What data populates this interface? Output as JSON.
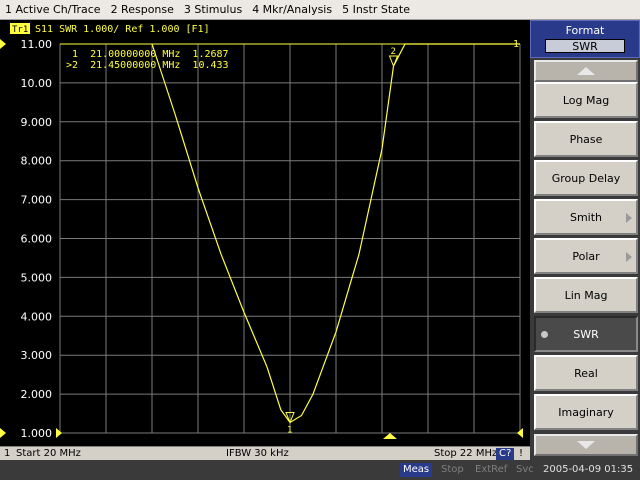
{
  "menu": [
    "1 Active Ch/Trace",
    "2 Response",
    "3 Stimulus",
    "4 Mkr/Analysis",
    "5 Instr State"
  ],
  "trace_header": {
    "trace_label": "Tr1",
    "trace_text": "S11  SWR 1.000/ Ref 1.000 [F1]"
  },
  "markers": [
    {
      "prefix": " 1",
      "freq": "21.00000000 MHz",
      "value": "1.2687"
    },
    {
      "prefix": ">2",
      "freq": "21.45000000 MHz",
      "value": "10.433"
    }
  ],
  "marker_flags": [
    "1",
    "2"
  ],
  "channel_ref_label": "1",
  "format_panel": {
    "title": "Format",
    "current": "SWR",
    "buttons": [
      {
        "label": "Log Mag",
        "submenu": false,
        "active": false
      },
      {
        "label": "Phase",
        "submenu": false,
        "active": false
      },
      {
        "label": "Group Delay",
        "submenu": false,
        "active": false
      },
      {
        "label": "Smith",
        "submenu": true,
        "active": false
      },
      {
        "label": "Polar",
        "submenu": true,
        "active": false
      },
      {
        "label": "Lin Mag",
        "submenu": false,
        "active": false
      },
      {
        "label": "SWR",
        "submenu": false,
        "active": true
      },
      {
        "label": "Real",
        "submenu": false,
        "active": false
      },
      {
        "label": "Imaginary",
        "submenu": false,
        "active": false
      }
    ]
  },
  "infobar": {
    "channel": "1",
    "start": "Start 20 MHz",
    "ifbw": "IFBW 30 kHz",
    "stop": "Stop 22 MHz",
    "cal": "C?",
    "flag": "!"
  },
  "statusbar": {
    "meas": "Meas",
    "stop": "Stop",
    "extref": "ExtRef",
    "svc": "Svc",
    "datetime": "2005-04-09 01:35"
  },
  "colors": {
    "trace": "#ffff40",
    "grid": "#7a7a7a",
    "plot_bg": "#000000",
    "meas_badge": "#2a3a8a"
  },
  "chart_data": {
    "type": "line",
    "xlim": [
      20,
      22
    ],
    "ylim": [
      1.0,
      11.0
    ],
    "y_ticks": [
      "11.00",
      "10.00",
      "9.000",
      "8.000",
      "7.000",
      "6.000",
      "5.000",
      "4.000",
      "3.000",
      "2.000",
      "1.000"
    ],
    "series": [
      {
        "x": [
          20.4,
          20.5,
          20.6,
          20.7,
          20.8,
          20.9,
          20.96,
          21.0,
          21.05,
          21.1,
          21.2,
          21.3,
          21.4,
          21.45,
          21.5
        ],
        "y": [
          11.0,
          9.2,
          7.3,
          5.6,
          4.1,
          2.7,
          1.6,
          1.2687,
          1.45,
          2.0,
          3.6,
          5.6,
          8.3,
          10.433,
          11.0
        ]
      }
    ],
    "markers": [
      {
        "id": "1",
        "x": 21.0,
        "y": 1.2687
      },
      {
        "id": "2",
        "x": 21.45,
        "y": 10.433
      }
    ]
  }
}
